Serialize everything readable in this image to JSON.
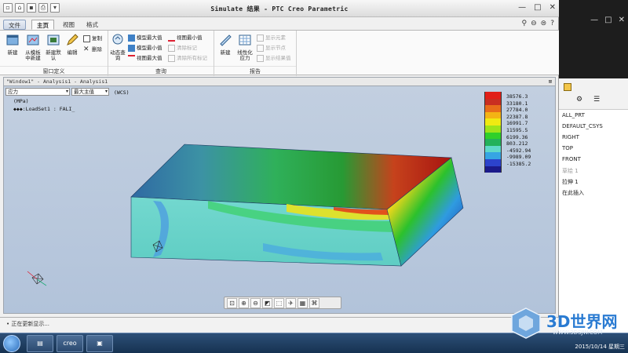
{
  "window": {
    "title": "Simulate 结果 - PTC Creo Parametric",
    "controls": [
      "—",
      "□",
      "✕"
    ]
  },
  "quick_access": [
    "new-icon",
    "open-icon",
    "save-icon",
    "print-icon",
    "more-icon"
  ],
  "tabs": [
    {
      "label": "文件",
      "kind": "file"
    },
    {
      "label": "主页",
      "kind": "active"
    },
    {
      "label": "视图",
      "kind": "normal"
    },
    {
      "label": "格式",
      "kind": "normal"
    }
  ],
  "ribbon": {
    "groups": [
      {
        "label": "窗口定义"
      },
      {
        "label": "查询"
      },
      {
        "label": "报告"
      }
    ],
    "window_buttons": [
      {
        "label": "新建",
        "icon": "new-window-icon"
      },
      {
        "label": "从模板中新建",
        "icon": "template-icon"
      },
      {
        "label": "新建默认",
        "icon": "new-default-icon"
      },
      {
        "label": "编辑",
        "icon": "edit-icon"
      }
    ],
    "window_small": [
      {
        "label": "复制",
        "icon": "copy-icon"
      },
      {
        "label": "删除",
        "icon": "delete-icon"
      }
    ],
    "query_big": {
      "label": "动态查询",
      "icon": "dynamic-query-icon"
    },
    "query_small": [
      {
        "label": "模型最大值",
        "icon": "model-max-icon",
        "dim": false
      },
      {
        "label": "模型最小值",
        "icon": "model-min-icon",
        "dim": false
      },
      {
        "label": "视图最大值",
        "icon": "view-max-icon",
        "dim": false
      },
      {
        "label": "视图最小值",
        "icon": "view-min-icon",
        "dim": false
      },
      {
        "label": "清除标记",
        "icon": "clear-tags-icon",
        "dim": true
      },
      {
        "label": "清除所有标记",
        "icon": "clear-all-tags-icon",
        "dim": true
      }
    ],
    "report_big": [
      {
        "label": "新建",
        "icon": "new-report-icon"
      },
      {
        "label": "线性化应力",
        "icon": "linearize-stress-icon"
      }
    ],
    "report_small": [
      {
        "label": "显示元素",
        "icon": "show-element-icon",
        "dim": true
      },
      {
        "label": "显示节点",
        "icon": "show-node-icon",
        "dim": true
      },
      {
        "label": "显示结果值",
        "icon": "show-result-icon",
        "dim": true
      }
    ]
  },
  "view": {
    "header": "\"Window1\" - Analysis1 - Analysis1",
    "quantity": "应力",
    "component": "最大主值",
    "cs": "(WCS)",
    "units": "(MPa)",
    "load": "◆◆◆:LoadSet1 : FALI_"
  },
  "legend": {
    "values": [
      "38576.3",
      "33180.1",
      "27784.0",
      "22387.8",
      "16991.7",
      "11595.5",
      "6199.36",
      "803.212",
      "-4592.94",
      "-9989.09",
      "-15385.2"
    ],
    "colors": [
      "#e11f18",
      "#c92e21",
      "#e86d1a",
      "#f4b314",
      "#f0ea12",
      "#9ee41a",
      "#2fd02a",
      "#23b15a",
      "#5fd9c9",
      "#36a5e3",
      "#2c43cc",
      "#1b1a8a"
    ]
  },
  "view_toolbar": [
    "zoom-fit-icon",
    "zoom-in-icon",
    "zoom-out-icon",
    "repaint-icon",
    "zoom-window-icon",
    "orient-icon",
    "saved-views-icon",
    "display-style-icon"
  ],
  "status": "• 正在更新显示...",
  "model_tree": {
    "items": [
      {
        "label": "ALL_PRT",
        "dim": false
      },
      {
        "label": "DEFAULT_CSYS",
        "dim": false
      },
      {
        "label": "RIGHT",
        "dim": false
      },
      {
        "label": "TOP",
        "dim": false
      },
      {
        "label": "FRONT",
        "dim": false
      },
      {
        "label": "草绘 1",
        "dim": true
      },
      {
        "label": "拉伸 1",
        "dim": false
      },
      {
        "label": "在此插入",
        "dim": false
      }
    ]
  },
  "taskbar": {
    "apps": [
      "explorer-icon",
      "creo-icon",
      "simulate-icon"
    ],
    "creo_label": "creo",
    "clock": "2015/10/14 星期三"
  },
  "watermark": {
    "text": "3D世界网",
    "url": "WWW.3DSJW.COM"
  }
}
